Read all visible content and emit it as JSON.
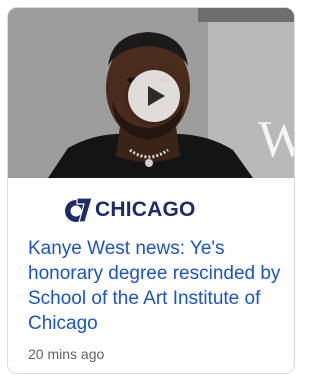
{
  "card": {
    "source": {
      "logo_text": "7",
      "name": "CHICAGO"
    },
    "headline": "Kanye West news: Ye's honorary degree rescinded by School of the Art Institute of Chicago",
    "timestamp": "20 mins ago",
    "thumbnail": {
      "backdrop_text": "W",
      "has_play_button": true
    }
  },
  "colors": {
    "headline": "#1a55c5",
    "source_name": "#1d2b66",
    "timestamp": "#5f6368",
    "border": "#dadce0"
  }
}
